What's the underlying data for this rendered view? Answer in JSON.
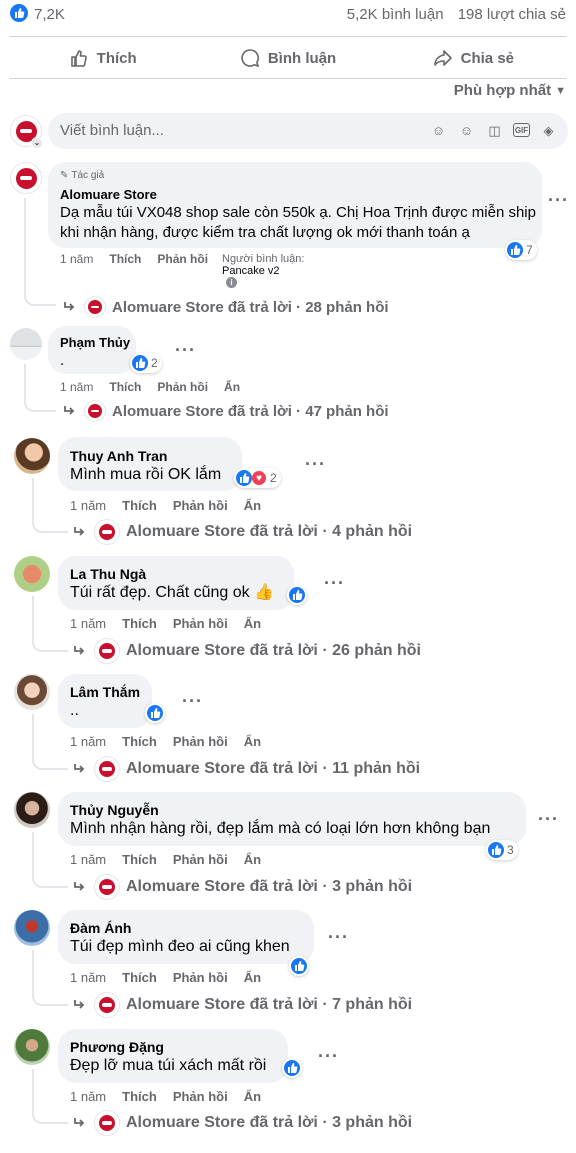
{
  "stats": {
    "likes": "7,2K",
    "comments": "5,2K bình luận",
    "shares": "198 lượt chia sẻ"
  },
  "actions": {
    "like": "Thích",
    "comment": "Bình luận",
    "share": "Chia sẻ"
  },
  "sort": {
    "label": "Phù hợp nhất"
  },
  "composer": {
    "placeholder": "Viết bình luận..."
  },
  "colors": {
    "accent": "#1877f2",
    "brand": "#c8102e"
  },
  "comments": [
    {
      "author_badge": "Tác giả",
      "name": "Alomuare Store",
      "text_line1": "Dạ mẫu túi VX048 shop sale còn 550k ạ. Chị Hoa Trịnh được miễn ship",
      "text_line2": "khi nhận hàng, được kiểm tra chất lượng ok mới thanh toán ạ",
      "time": "1 năm",
      "like": "Thích",
      "reply": "Phản hồi",
      "commenter_label": "Người bình luận:",
      "commenter_app": "Pancake v2",
      "reactions": "7",
      "replies": "Alomuare Store đã trả lời · 28 phản hồi"
    },
    {
      "name": "Phạm Thủy",
      "text": ".",
      "time": "1 năm",
      "like": "Thích",
      "reply": "Phản hồi",
      "hide": "Ẩn",
      "reactions": "2",
      "replies": "Alomuare Store đã trả lời · 47 phản hồi"
    },
    {
      "name": "Thuy Anh Tran",
      "text": "Mình mua rồi OK lắm",
      "time": "1 năm",
      "like": "Thích",
      "reply": "Phản hồi",
      "hide": "Ẩn",
      "reactions": "2",
      "replies": "Alomuare Store đã trả lời · 4 phản hồi"
    },
    {
      "name": "La Thu Ngà",
      "text": "Túi rất đẹp. Chất cũng ok 👍",
      "time": "1 năm",
      "like": "Thích",
      "reply": "Phản hồi",
      "hide": "Ẩn",
      "replies": "Alomuare Store đã trả lời · 26 phản hồi"
    },
    {
      "name": "Lâm Thắm",
      "text": "..",
      "time": "1 năm",
      "like": "Thích",
      "reply": "Phản hồi",
      "hide": "Ẩn",
      "replies": "Alomuare Store đã trả lời · 11 phản hồi"
    },
    {
      "name": "Thủy Nguyễn",
      "text": "Mình nhận hàng rồi, đẹp lắm mà có loại lớn hơn không bạn",
      "time": "1 năm",
      "like": "Thích",
      "reply": "Phản hồi",
      "hide": "Ẩn",
      "reactions": "3",
      "replies": "Alomuare Store đã trả lời · 3 phản hồi"
    },
    {
      "name": "Đàm Ánh",
      "text": "Túi đẹp mình đeo ai cũng khen",
      "time": "1 năm",
      "like": "Thích",
      "reply": "Phản hồi",
      "hide": "Ẩn",
      "replies": "Alomuare Store đã trả lời · 7 phản hồi"
    },
    {
      "name": "Phương Đặng",
      "text": "Đẹp lỡ mua túi xách mất rồi",
      "time": "1 năm",
      "like": "Thích",
      "reply": "Phản hồi",
      "hide": "Ẩn",
      "replies": "Alomuare Store đã trả lời · 3 phản hồi"
    }
  ]
}
